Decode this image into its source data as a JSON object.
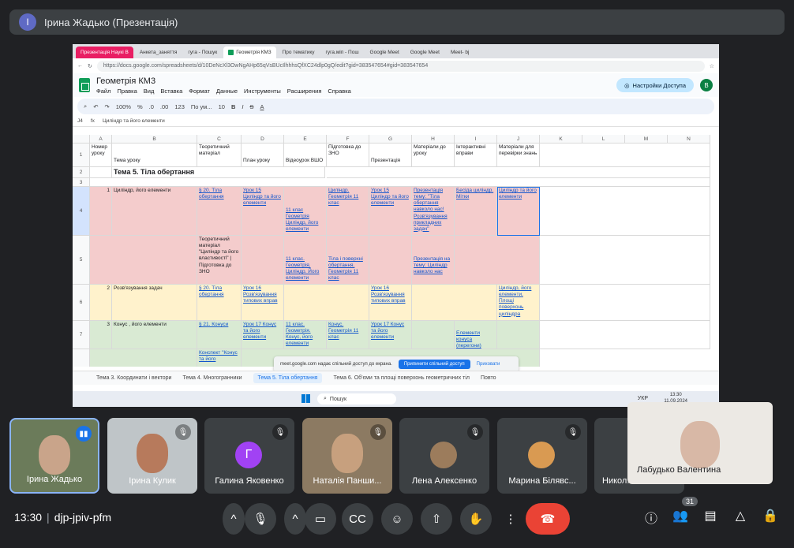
{
  "presenter": {
    "avatar": "І",
    "title": "Ірина Жадько (Презентація)"
  },
  "browser": {
    "tabs": [
      "Презентація Наукі B",
      "Анкета_заняття",
      "гуга - Пошук",
      "Геометрія КМ3",
      "Про тематику",
      "гуга.міп - Пош",
      "Google Meet",
      "Google Meet",
      "Meet- bj"
    ],
    "url": "https://docs.google.com/spreadsheets/d/10DeNcXl3OwNgAHp65qVsBUcIlhhhsQfXC24dlp0gQ/edit?gid=383547654#gid=383547654"
  },
  "doc": {
    "title": "Геометрія КМ3",
    "menus": [
      "Файл",
      "Правка",
      "Вид",
      "Вставка",
      "Формат",
      "Данные",
      "Инструменты",
      "Расширения",
      "Справка"
    ],
    "share": "Настройки Доступа",
    "user": "B"
  },
  "toolbar": {
    "zoom": "100%",
    "font": "По ум...",
    "size": "10",
    "pct": "%",
    "dec1": ".0",
    "dec2": ".00",
    "num": "123"
  },
  "formula": {
    "ref": "J4",
    "fx": "fx",
    "value": "Циліндр та його елементи"
  },
  "sheet": {
    "cols": [
      "A",
      "B",
      "C",
      "D",
      "E",
      "F",
      "G",
      "H",
      "I",
      "J",
      "K",
      "L",
      "M",
      "N"
    ],
    "rows": [
      "1",
      "2",
      "3",
      "4",
      "5",
      "6",
      "7"
    ],
    "headers": [
      "Номер уроку",
      "Тема уроку",
      "Теоретичний матеріал",
      "План уроку",
      "Відеоурок ВШО",
      "Підготовка до ЗНО",
      "Презентація",
      "Матеріали до уроку",
      "Інтерактивні вправи",
      "Матеріали для перевірки знань"
    ],
    "theme": "Тема 5. Тіла обертання",
    "r4": {
      "a": "1",
      "b": "Циліндр, його елементи",
      "c": "§ 20. Тіла обертання",
      "d": "Урок 15 Циліндр та його елементи",
      "e": "11 клас Геометрія Циліндр, його елементи",
      "f": "Циліндр. Геометрія 11 клас",
      "g": "Урок 15 Циліндр та його елементи",
      "h": "Презентація тему: \"Тіла обертання навколо нас! Розв'язування прикладних задач\"",
      "i": "Бесіда циліндр. Мітки",
      "j": "Циліндр та його елементи"
    },
    "r5": {
      "c": "Теоретичний матеріал \"Циліндр та його властивості\" | Підготовка до ЗНО",
      "e": "11 клас. Геометрія. Циліндр. Його елементи",
      "f": "Тіла і поверхні обертання. Геометрія 11 клас",
      "h": "Презентація на тему: Циліндр навколо нас"
    },
    "r6": {
      "a": "2",
      "b": "Розв'язування задач",
      "c": "§ 20. Тіла обертання",
      "d": "Урок 16 Розв'язування типових вправ",
      "g": "Урок 16 Розв'язування типових вправ",
      "j": "Циліндр, його елементи. Площі поверхонь циліндра"
    },
    "r7": {
      "a": "3",
      "b": "Конус , його елементи",
      "c": "§ 21. Конуси",
      "d": "Урок 17 Конус та його елементи",
      "e": "11 клас. Геометрія. Конус, його елементи",
      "f": "Конус. Геометрія 11 клас",
      "g": "Урок 17 Конус та його елементи",
      "i": "Елементи конуса (перегони)"
    },
    "r8": {
      "c": "Конспект \"Конус та його"
    }
  },
  "banner": {
    "text": "meet.google.com надає спільний доступ до екрана.",
    "stop": "Припинити спільний доступ",
    "hide": "Приховати"
  },
  "sheet_tabs": [
    "Тема 3. Координати і вектори",
    "Тема 4. Многогранники",
    "Тема 5. Тіла обертання",
    "Тема 6. Об'єми та площі поверхонь геометричних тіл",
    "Повто"
  ],
  "taskbar": {
    "search": "Пошук",
    "lang": "УКР",
    "time": "13:30",
    "date": "11.09.2024"
  },
  "participants": [
    {
      "name": "Ірина Жадько",
      "mic": "on",
      "type": "video"
    },
    {
      "name": "Ірина Кулик",
      "mic": "muted",
      "type": "video"
    },
    {
      "name": "Галина Яковенко",
      "mic": "muted",
      "type": "avatar",
      "letter": "Г",
      "color": "#a142f4"
    },
    {
      "name": "Наталія Панши...",
      "mic": "muted",
      "type": "video"
    },
    {
      "name": "Лена Алексенко",
      "mic": "muted",
      "type": "photo"
    },
    {
      "name": "Марина Білявс...",
      "mic": "muted",
      "type": "photo"
    },
    {
      "name": "Никол...",
      "mic": "muted",
      "type": "video"
    }
  ],
  "self_view": {
    "name": "Лабудько Валентина"
  },
  "meeting": {
    "time": "13:30",
    "code": "djp-jpiv-pfm",
    "participants_count": "31"
  }
}
